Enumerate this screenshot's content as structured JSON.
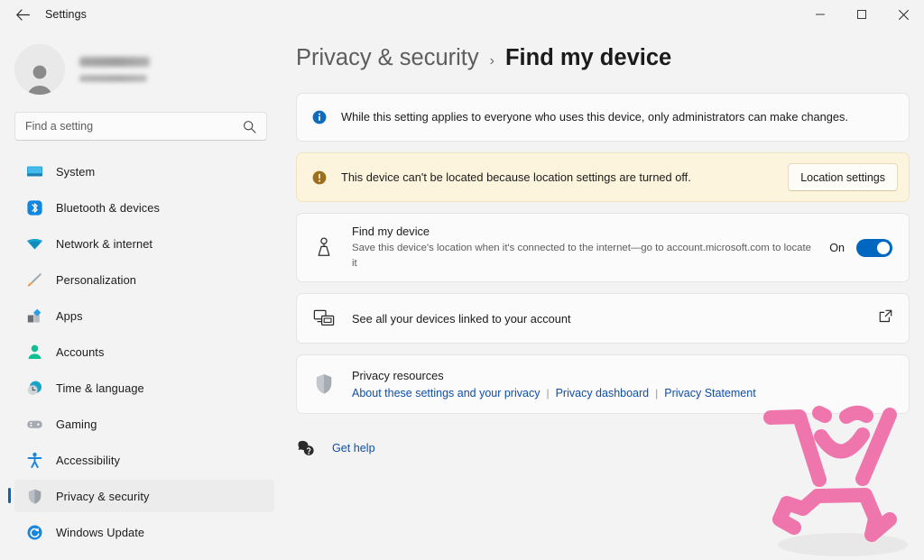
{
  "window": {
    "title": "Settings",
    "back_label": "Back",
    "controls": {
      "minimize": "Minimize",
      "maximize": "Maximize",
      "close": "Close"
    }
  },
  "sidebar": {
    "account": {
      "name_redacted": "",
      "email_redacted": ""
    },
    "search": {
      "placeholder": "Find a setting",
      "value": ""
    },
    "items": [
      {
        "label": "System",
        "icon": "monitor-icon",
        "selected": false
      },
      {
        "label": "Bluetooth & devices",
        "icon": "bluetooth-icon",
        "selected": false
      },
      {
        "label": "Network & internet",
        "icon": "wifi-icon",
        "selected": false
      },
      {
        "label": "Personalization",
        "icon": "paintbrush-icon",
        "selected": false
      },
      {
        "label": "Apps",
        "icon": "apps-icon",
        "selected": false
      },
      {
        "label": "Accounts",
        "icon": "person-icon",
        "selected": false
      },
      {
        "label": "Time & language",
        "icon": "clock-icon",
        "selected": false
      },
      {
        "label": "Gaming",
        "icon": "gamepad-icon",
        "selected": false
      },
      {
        "label": "Accessibility",
        "icon": "accessibility-icon",
        "selected": false
      },
      {
        "label": "Privacy & security",
        "icon": "shield-icon",
        "selected": true
      },
      {
        "label": "Windows Update",
        "icon": "update-icon",
        "selected": false
      }
    ]
  },
  "main": {
    "breadcrumb": {
      "parent": "Privacy & security",
      "separator": "›",
      "current": "Find my device"
    },
    "info_banner": {
      "icon": "info-icon",
      "text": "While this setting applies to everyone who uses this device, only administrators can make changes."
    },
    "warning_banner": {
      "icon": "warning-icon",
      "text": "This device can't be located because location settings are turned off.",
      "button_label": "Location settings"
    },
    "find_my_device": {
      "icon": "location-person-icon",
      "title": "Find my device",
      "description": "Save this device's location when it's connected to the internet—go to account.microsoft.com to locate it",
      "toggle_state": "On",
      "toggle_on": true
    },
    "linked_devices": {
      "icon": "devices-icon",
      "label": "See all your devices linked to your account",
      "external_icon": "external-link-icon"
    },
    "privacy_resources": {
      "icon": "shield-icon",
      "title": "Privacy resources",
      "links": [
        "About these settings and your privacy",
        "Privacy dashboard",
        "Privacy Statement"
      ],
      "separator": "|"
    },
    "get_help": {
      "icon": "help-icon",
      "label": "Get help"
    }
  },
  "overlay": {
    "doodle": {
      "name": "pink-stick-figure-doodle",
      "color": "#ef76ad"
    }
  },
  "colors": {
    "accent": "#0067c0",
    "link": "#0f4fa8",
    "warning_bg": "#fdf4dd",
    "warning_icon": "#9b6f1c",
    "page_bg": "#f3f3f3",
    "card_bg": "#fbfbfb"
  }
}
